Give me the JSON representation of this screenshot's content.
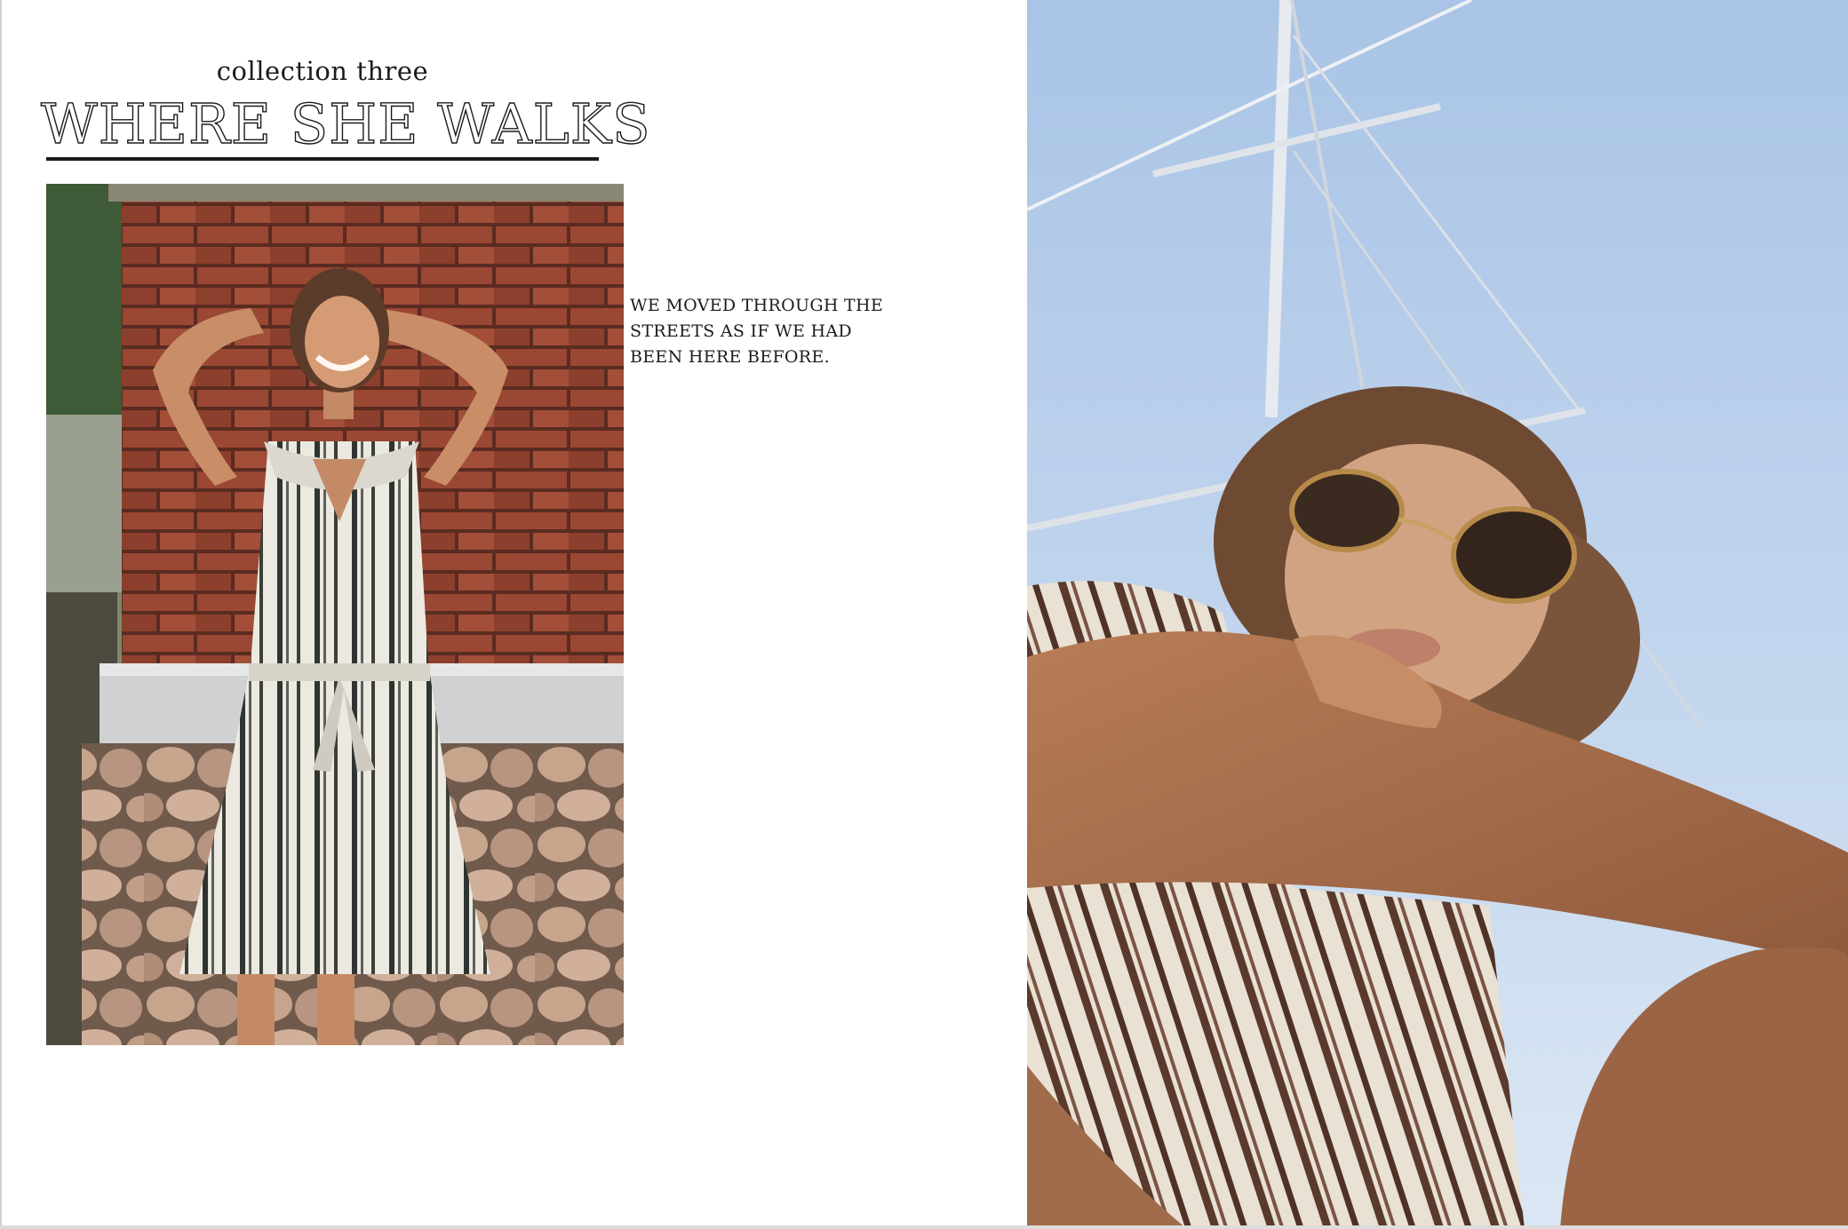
{
  "page": {
    "kicker": "collection three",
    "title": "WHERE SHE WALKS",
    "caption_lines": [
      "WE MOVED THROUGH THE",
      "STREETS AS IF WE HAD",
      "BEEN HERE BEFORE."
    ]
  },
  "colors": {
    "ink": "#1a1a1a",
    "sky": "#b9d0ec",
    "brick": "#8e3f2c",
    "skin": "#b57a55"
  }
}
